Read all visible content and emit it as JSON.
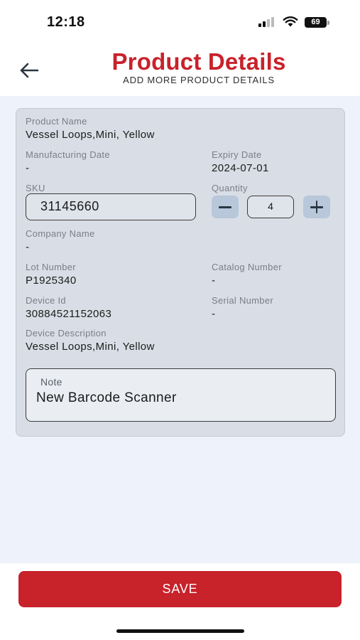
{
  "status_bar": {
    "time": "12:18",
    "battery": "69"
  },
  "header": {
    "title": "Product Details",
    "subtitle": "ADD MORE PRODUCT DETAILS",
    "back_icon": "arrow-left-icon"
  },
  "product": {
    "product_name": {
      "label": "Product Name",
      "value": "Vessel Loops,Mini, Yellow"
    },
    "manufacturing_date": {
      "label": "Manufacturing Date",
      "value": "-"
    },
    "expiry_date": {
      "label": "Expiry Date",
      "value": "2024-07-01"
    },
    "sku": {
      "label": "SKU",
      "value": "31145660"
    },
    "quantity": {
      "label": "Quantity",
      "value": "4",
      "minus_icon": "minus-icon",
      "plus_icon": "plus-icon"
    },
    "company_name": {
      "label": "Company Name",
      "value": "-"
    },
    "lot_number": {
      "label": "Lot Number",
      "value": "P1925340"
    },
    "catalog_number": {
      "label": "Catalog Number",
      "value": "-"
    },
    "device_id": {
      "label": "Device Id",
      "value": "30884521152063"
    },
    "serial_number": {
      "label": "Serial Number",
      "value": "-"
    },
    "device_description": {
      "label": "Device Description",
      "value": "Vessel Loops,Mini, Yellow"
    },
    "note": {
      "label": "Note",
      "value": "New Barcode Scanner"
    }
  },
  "footer": {
    "save_label": "SAVE"
  },
  "colors": {
    "brand_red": "#c8222b",
    "card_bg": "#d9dee6",
    "page_bg": "#eef2fa",
    "stepper_bg": "#b8c7da"
  }
}
